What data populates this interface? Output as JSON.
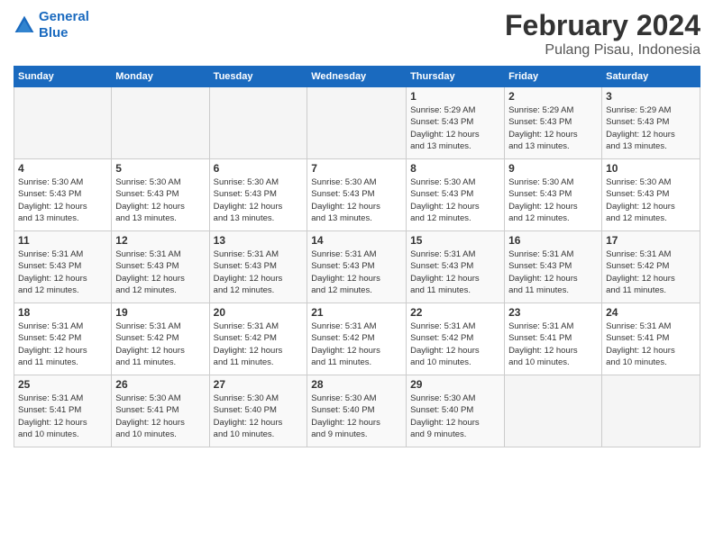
{
  "header": {
    "logo_line1": "General",
    "logo_line2": "Blue",
    "title": "February 2024",
    "subtitle": "Pulang Pisau, Indonesia"
  },
  "weekdays": [
    "Sunday",
    "Monday",
    "Tuesday",
    "Wednesday",
    "Thursday",
    "Friday",
    "Saturday"
  ],
  "weeks": [
    [
      {
        "day": "",
        "info": ""
      },
      {
        "day": "",
        "info": ""
      },
      {
        "day": "",
        "info": ""
      },
      {
        "day": "",
        "info": ""
      },
      {
        "day": "1",
        "info": "Sunrise: 5:29 AM\nSunset: 5:43 PM\nDaylight: 12 hours\nand 13 minutes."
      },
      {
        "day": "2",
        "info": "Sunrise: 5:29 AM\nSunset: 5:43 PM\nDaylight: 12 hours\nand 13 minutes."
      },
      {
        "day": "3",
        "info": "Sunrise: 5:29 AM\nSunset: 5:43 PM\nDaylight: 12 hours\nand 13 minutes."
      }
    ],
    [
      {
        "day": "4",
        "info": "Sunrise: 5:30 AM\nSunset: 5:43 PM\nDaylight: 12 hours\nand 13 minutes."
      },
      {
        "day": "5",
        "info": "Sunrise: 5:30 AM\nSunset: 5:43 PM\nDaylight: 12 hours\nand 13 minutes."
      },
      {
        "day": "6",
        "info": "Sunrise: 5:30 AM\nSunset: 5:43 PM\nDaylight: 12 hours\nand 13 minutes."
      },
      {
        "day": "7",
        "info": "Sunrise: 5:30 AM\nSunset: 5:43 PM\nDaylight: 12 hours\nand 13 minutes."
      },
      {
        "day": "8",
        "info": "Sunrise: 5:30 AM\nSunset: 5:43 PM\nDaylight: 12 hours\nand 12 minutes."
      },
      {
        "day": "9",
        "info": "Sunrise: 5:30 AM\nSunset: 5:43 PM\nDaylight: 12 hours\nand 12 minutes."
      },
      {
        "day": "10",
        "info": "Sunrise: 5:30 AM\nSunset: 5:43 PM\nDaylight: 12 hours\nand 12 minutes."
      }
    ],
    [
      {
        "day": "11",
        "info": "Sunrise: 5:31 AM\nSunset: 5:43 PM\nDaylight: 12 hours\nand 12 minutes."
      },
      {
        "day": "12",
        "info": "Sunrise: 5:31 AM\nSunset: 5:43 PM\nDaylight: 12 hours\nand 12 minutes."
      },
      {
        "day": "13",
        "info": "Sunrise: 5:31 AM\nSunset: 5:43 PM\nDaylight: 12 hours\nand 12 minutes."
      },
      {
        "day": "14",
        "info": "Sunrise: 5:31 AM\nSunset: 5:43 PM\nDaylight: 12 hours\nand 12 minutes."
      },
      {
        "day": "15",
        "info": "Sunrise: 5:31 AM\nSunset: 5:43 PM\nDaylight: 12 hours\nand 11 minutes."
      },
      {
        "day": "16",
        "info": "Sunrise: 5:31 AM\nSunset: 5:43 PM\nDaylight: 12 hours\nand 11 minutes."
      },
      {
        "day": "17",
        "info": "Sunrise: 5:31 AM\nSunset: 5:42 PM\nDaylight: 12 hours\nand 11 minutes."
      }
    ],
    [
      {
        "day": "18",
        "info": "Sunrise: 5:31 AM\nSunset: 5:42 PM\nDaylight: 12 hours\nand 11 minutes."
      },
      {
        "day": "19",
        "info": "Sunrise: 5:31 AM\nSunset: 5:42 PM\nDaylight: 12 hours\nand 11 minutes."
      },
      {
        "day": "20",
        "info": "Sunrise: 5:31 AM\nSunset: 5:42 PM\nDaylight: 12 hours\nand 11 minutes."
      },
      {
        "day": "21",
        "info": "Sunrise: 5:31 AM\nSunset: 5:42 PM\nDaylight: 12 hours\nand 11 minutes."
      },
      {
        "day": "22",
        "info": "Sunrise: 5:31 AM\nSunset: 5:42 PM\nDaylight: 12 hours\nand 10 minutes."
      },
      {
        "day": "23",
        "info": "Sunrise: 5:31 AM\nSunset: 5:41 PM\nDaylight: 12 hours\nand 10 minutes."
      },
      {
        "day": "24",
        "info": "Sunrise: 5:31 AM\nSunset: 5:41 PM\nDaylight: 12 hours\nand 10 minutes."
      }
    ],
    [
      {
        "day": "25",
        "info": "Sunrise: 5:31 AM\nSunset: 5:41 PM\nDaylight: 12 hours\nand 10 minutes."
      },
      {
        "day": "26",
        "info": "Sunrise: 5:30 AM\nSunset: 5:41 PM\nDaylight: 12 hours\nand 10 minutes."
      },
      {
        "day": "27",
        "info": "Sunrise: 5:30 AM\nSunset: 5:40 PM\nDaylight: 12 hours\nand 10 minutes."
      },
      {
        "day": "28",
        "info": "Sunrise: 5:30 AM\nSunset: 5:40 PM\nDaylight: 12 hours\nand 9 minutes."
      },
      {
        "day": "29",
        "info": "Sunrise: 5:30 AM\nSunset: 5:40 PM\nDaylight: 12 hours\nand 9 minutes."
      },
      {
        "day": "",
        "info": ""
      },
      {
        "day": "",
        "info": ""
      }
    ]
  ]
}
